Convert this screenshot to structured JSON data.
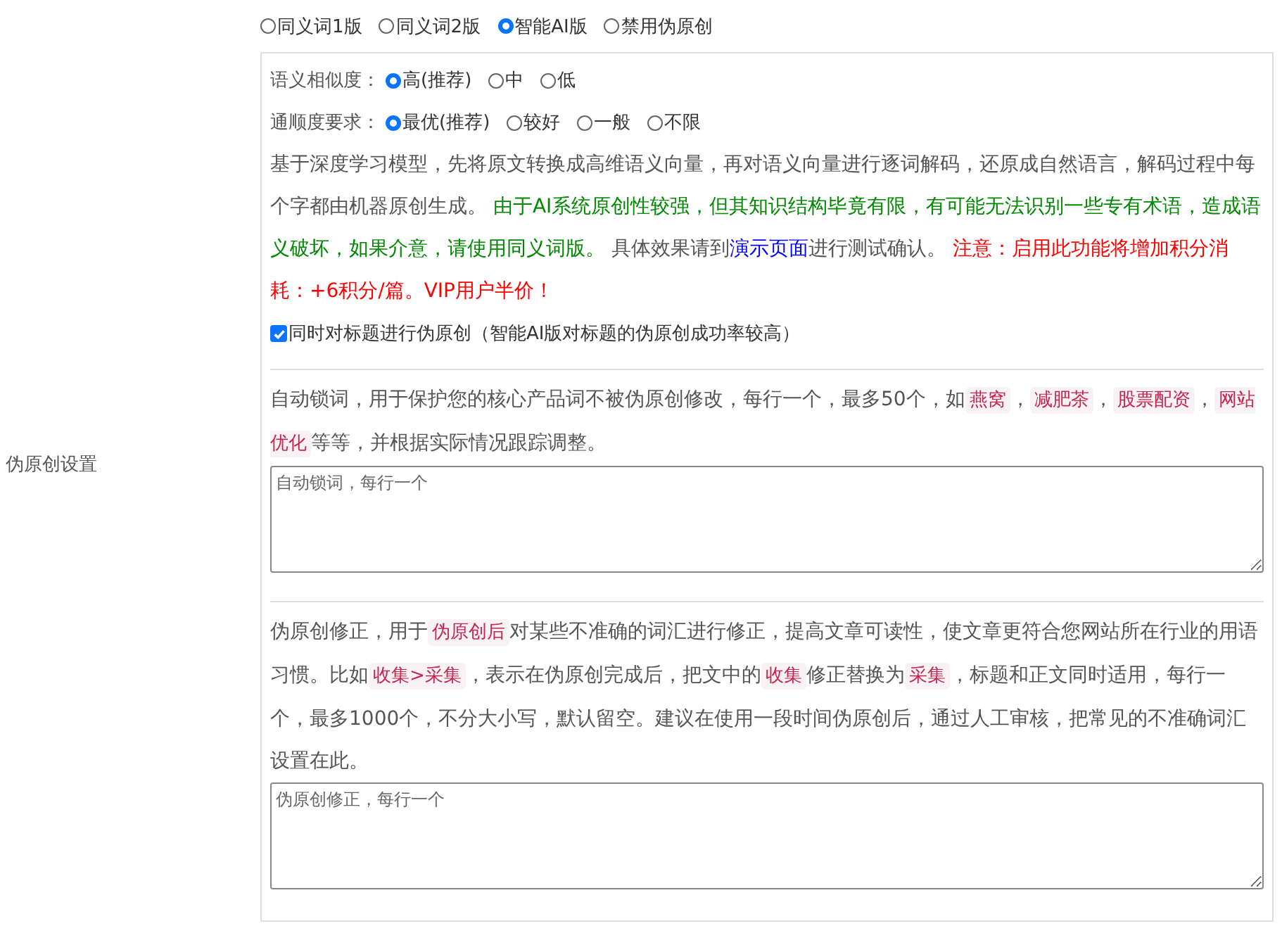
{
  "label": "伪原创设置",
  "modes": [
    {
      "label": "同义词1版",
      "selected": false
    },
    {
      "label": "同义词2版",
      "selected": false
    },
    {
      "label": "智能AI版",
      "selected": true
    },
    {
      "label": "禁用伪原创",
      "selected": false
    }
  ],
  "similarity": {
    "label": "语义相似度：",
    "options": [
      {
        "label": "高(推荐)",
        "selected": true
      },
      {
        "label": "中",
        "selected": false
      },
      {
        "label": "低",
        "selected": false
      }
    ]
  },
  "fluency": {
    "label": "通顺度要求：",
    "options": [
      {
        "label": "最优(推荐)",
        "selected": true
      },
      {
        "label": "较好",
        "selected": false
      },
      {
        "label": "一般",
        "selected": false
      },
      {
        "label": "不限",
        "selected": false
      }
    ]
  },
  "description": [
    {
      "kind": "text",
      "text": "基于深度学习模型，先将原文转换成高维语义向量，再对语义向量进行逐词解码，还原成自然语言，解码过程中每个字都由机器原创生成。 "
    },
    {
      "kind": "notice",
      "text": "由于AI系统原创性较强，但其知识结构毕竟有限，有可能无法识别一些专有术语，造成语义破坏，如果介意，请使用同义词版。"
    },
    {
      "kind": "text",
      "text": " 具体效果请到"
    },
    {
      "kind": "link",
      "text": "演示页面"
    },
    {
      "kind": "text",
      "text": "进行测试确认。 "
    },
    {
      "kind": "warning",
      "text": "注意：启用此功能将增加积分消耗：+6积分/篇。VIP用户半价！"
    }
  ],
  "title_option": {
    "checked": true,
    "label": "同时对标题进行伪原创（智能AI版对标题的伪原创成功率较高）"
  },
  "lock": {
    "segments": [
      {
        "kind": "text",
        "text": "自动锁词，用于保护您的核心产品词不被伪原创修改，每行一个，最多50个，如"
      },
      {
        "kind": "tag",
        "text": "燕窝"
      },
      {
        "kind": "text",
        "text": "，"
      },
      {
        "kind": "tag",
        "text": "减肥茶"
      },
      {
        "kind": "text",
        "text": "，"
      },
      {
        "kind": "tag",
        "text": "股票配资"
      },
      {
        "kind": "text",
        "text": "，"
      },
      {
        "kind": "tag",
        "text": "网站优化"
      },
      {
        "kind": "text",
        "text": "等等，并根据实际情况跟踪调整。"
      }
    ],
    "placeholder": "自动锁词，每行一个"
  },
  "correction": {
    "segments": [
      {
        "kind": "text",
        "text": "伪原创修正，用于"
      },
      {
        "kind": "tag",
        "text": "伪原创后"
      },
      {
        "kind": "text",
        "text": "对某些不准确的词汇进行修正，提高文章可读性，使文章更符合您网站所在行业的用语习惯。比如"
      },
      {
        "kind": "tag",
        "text": "收集>采集"
      },
      {
        "kind": "text",
        "text": "，表示在伪原创完成后，把文中的"
      },
      {
        "kind": "tag",
        "text": "收集"
      },
      {
        "kind": "text",
        "text": "修正替换为"
      },
      {
        "kind": "tag",
        "text": "采集"
      },
      {
        "kind": "text",
        "text": "，标题和正文同时适用，每行一个，最多1000个，不分大小写，默认留空。建议在使用一段时间伪原创后，通过人工审核，把常见的不准确词汇设置在此。"
      }
    ],
    "placeholder": "伪原创修正，每行一个"
  }
}
